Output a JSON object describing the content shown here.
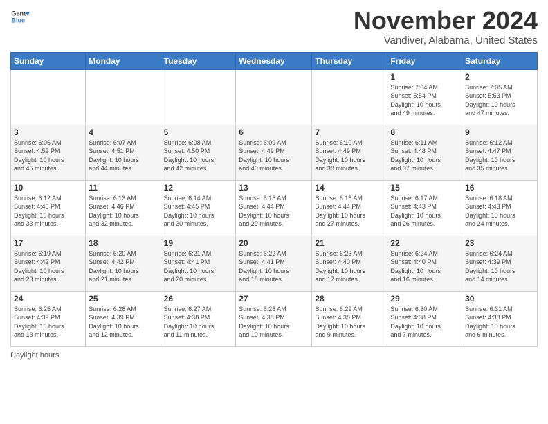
{
  "logo": {
    "text_general": "General",
    "text_blue": "Blue"
  },
  "header": {
    "month": "November 2024",
    "location": "Vandiver, Alabama, United States"
  },
  "days_of_week": [
    "Sunday",
    "Monday",
    "Tuesday",
    "Wednesday",
    "Thursday",
    "Friday",
    "Saturday"
  ],
  "footer": {
    "label": "Daylight hours"
  },
  "weeks": [
    {
      "days": [
        {
          "num": "",
          "info": ""
        },
        {
          "num": "",
          "info": ""
        },
        {
          "num": "",
          "info": ""
        },
        {
          "num": "",
          "info": ""
        },
        {
          "num": "",
          "info": ""
        },
        {
          "num": "1",
          "info": "Sunrise: 7:04 AM\nSunset: 5:54 PM\nDaylight: 10 hours\nand 49 minutes."
        },
        {
          "num": "2",
          "info": "Sunrise: 7:05 AM\nSunset: 5:53 PM\nDaylight: 10 hours\nand 47 minutes."
        }
      ]
    },
    {
      "days": [
        {
          "num": "3",
          "info": "Sunrise: 6:06 AM\nSunset: 4:52 PM\nDaylight: 10 hours\nand 45 minutes."
        },
        {
          "num": "4",
          "info": "Sunrise: 6:07 AM\nSunset: 4:51 PM\nDaylight: 10 hours\nand 44 minutes."
        },
        {
          "num": "5",
          "info": "Sunrise: 6:08 AM\nSunset: 4:50 PM\nDaylight: 10 hours\nand 42 minutes."
        },
        {
          "num": "6",
          "info": "Sunrise: 6:09 AM\nSunset: 4:49 PM\nDaylight: 10 hours\nand 40 minutes."
        },
        {
          "num": "7",
          "info": "Sunrise: 6:10 AM\nSunset: 4:49 PM\nDaylight: 10 hours\nand 38 minutes."
        },
        {
          "num": "8",
          "info": "Sunrise: 6:11 AM\nSunset: 4:48 PM\nDaylight: 10 hours\nand 37 minutes."
        },
        {
          "num": "9",
          "info": "Sunrise: 6:12 AM\nSunset: 4:47 PM\nDaylight: 10 hours\nand 35 minutes."
        }
      ]
    },
    {
      "days": [
        {
          "num": "10",
          "info": "Sunrise: 6:12 AM\nSunset: 4:46 PM\nDaylight: 10 hours\nand 33 minutes."
        },
        {
          "num": "11",
          "info": "Sunrise: 6:13 AM\nSunset: 4:46 PM\nDaylight: 10 hours\nand 32 minutes."
        },
        {
          "num": "12",
          "info": "Sunrise: 6:14 AM\nSunset: 4:45 PM\nDaylight: 10 hours\nand 30 minutes."
        },
        {
          "num": "13",
          "info": "Sunrise: 6:15 AM\nSunset: 4:44 PM\nDaylight: 10 hours\nand 29 minutes."
        },
        {
          "num": "14",
          "info": "Sunrise: 6:16 AM\nSunset: 4:44 PM\nDaylight: 10 hours\nand 27 minutes."
        },
        {
          "num": "15",
          "info": "Sunrise: 6:17 AM\nSunset: 4:43 PM\nDaylight: 10 hours\nand 26 minutes."
        },
        {
          "num": "16",
          "info": "Sunrise: 6:18 AM\nSunset: 4:43 PM\nDaylight: 10 hours\nand 24 minutes."
        }
      ]
    },
    {
      "days": [
        {
          "num": "17",
          "info": "Sunrise: 6:19 AM\nSunset: 4:42 PM\nDaylight: 10 hours\nand 23 minutes."
        },
        {
          "num": "18",
          "info": "Sunrise: 6:20 AM\nSunset: 4:42 PM\nDaylight: 10 hours\nand 21 minutes."
        },
        {
          "num": "19",
          "info": "Sunrise: 6:21 AM\nSunset: 4:41 PM\nDaylight: 10 hours\nand 20 minutes."
        },
        {
          "num": "20",
          "info": "Sunrise: 6:22 AM\nSunset: 4:41 PM\nDaylight: 10 hours\nand 18 minutes."
        },
        {
          "num": "21",
          "info": "Sunrise: 6:23 AM\nSunset: 4:40 PM\nDaylight: 10 hours\nand 17 minutes."
        },
        {
          "num": "22",
          "info": "Sunrise: 6:24 AM\nSunset: 4:40 PM\nDaylight: 10 hours\nand 16 minutes."
        },
        {
          "num": "23",
          "info": "Sunrise: 6:24 AM\nSunset: 4:39 PM\nDaylight: 10 hours\nand 14 minutes."
        }
      ]
    },
    {
      "days": [
        {
          "num": "24",
          "info": "Sunrise: 6:25 AM\nSunset: 4:39 PM\nDaylight: 10 hours\nand 13 minutes."
        },
        {
          "num": "25",
          "info": "Sunrise: 6:26 AM\nSunset: 4:39 PM\nDaylight: 10 hours\nand 12 minutes."
        },
        {
          "num": "26",
          "info": "Sunrise: 6:27 AM\nSunset: 4:38 PM\nDaylight: 10 hours\nand 11 minutes."
        },
        {
          "num": "27",
          "info": "Sunrise: 6:28 AM\nSunset: 4:38 PM\nDaylight: 10 hours\nand 10 minutes."
        },
        {
          "num": "28",
          "info": "Sunrise: 6:29 AM\nSunset: 4:38 PM\nDaylight: 10 hours\nand 9 minutes."
        },
        {
          "num": "29",
          "info": "Sunrise: 6:30 AM\nSunset: 4:38 PM\nDaylight: 10 hours\nand 7 minutes."
        },
        {
          "num": "30",
          "info": "Sunrise: 6:31 AM\nSunset: 4:38 PM\nDaylight: 10 hours\nand 6 minutes."
        }
      ]
    }
  ]
}
